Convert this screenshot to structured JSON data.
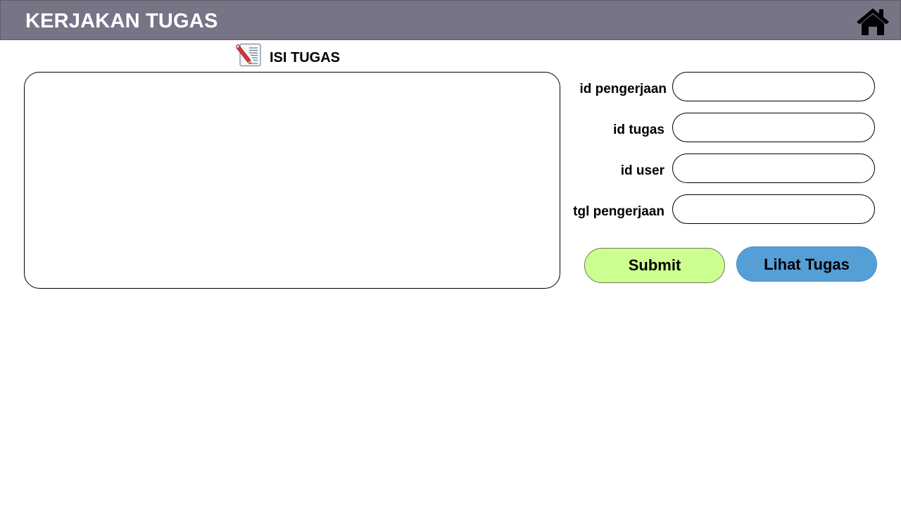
{
  "header": {
    "title": "KERJAKAN TUGAS",
    "home_icon": "home-icon"
  },
  "task_section": {
    "heading": "ISI TUGAS",
    "icon": "document-pencil-icon",
    "content_value": ""
  },
  "form": {
    "fields": [
      {
        "label": "id pengerjaan",
        "value": ""
      },
      {
        "label": "id tugas",
        "value": ""
      },
      {
        "label": "id user",
        "value": ""
      },
      {
        "label": "tgl pengerjaan",
        "value": ""
      }
    ]
  },
  "buttons": {
    "submit_label": "Submit",
    "view_tasks_label": "Lihat Tugas"
  },
  "colors": {
    "header_bg": "#787486",
    "submit_bg": "#ccff8f",
    "view_tasks_bg": "#569ed6"
  }
}
